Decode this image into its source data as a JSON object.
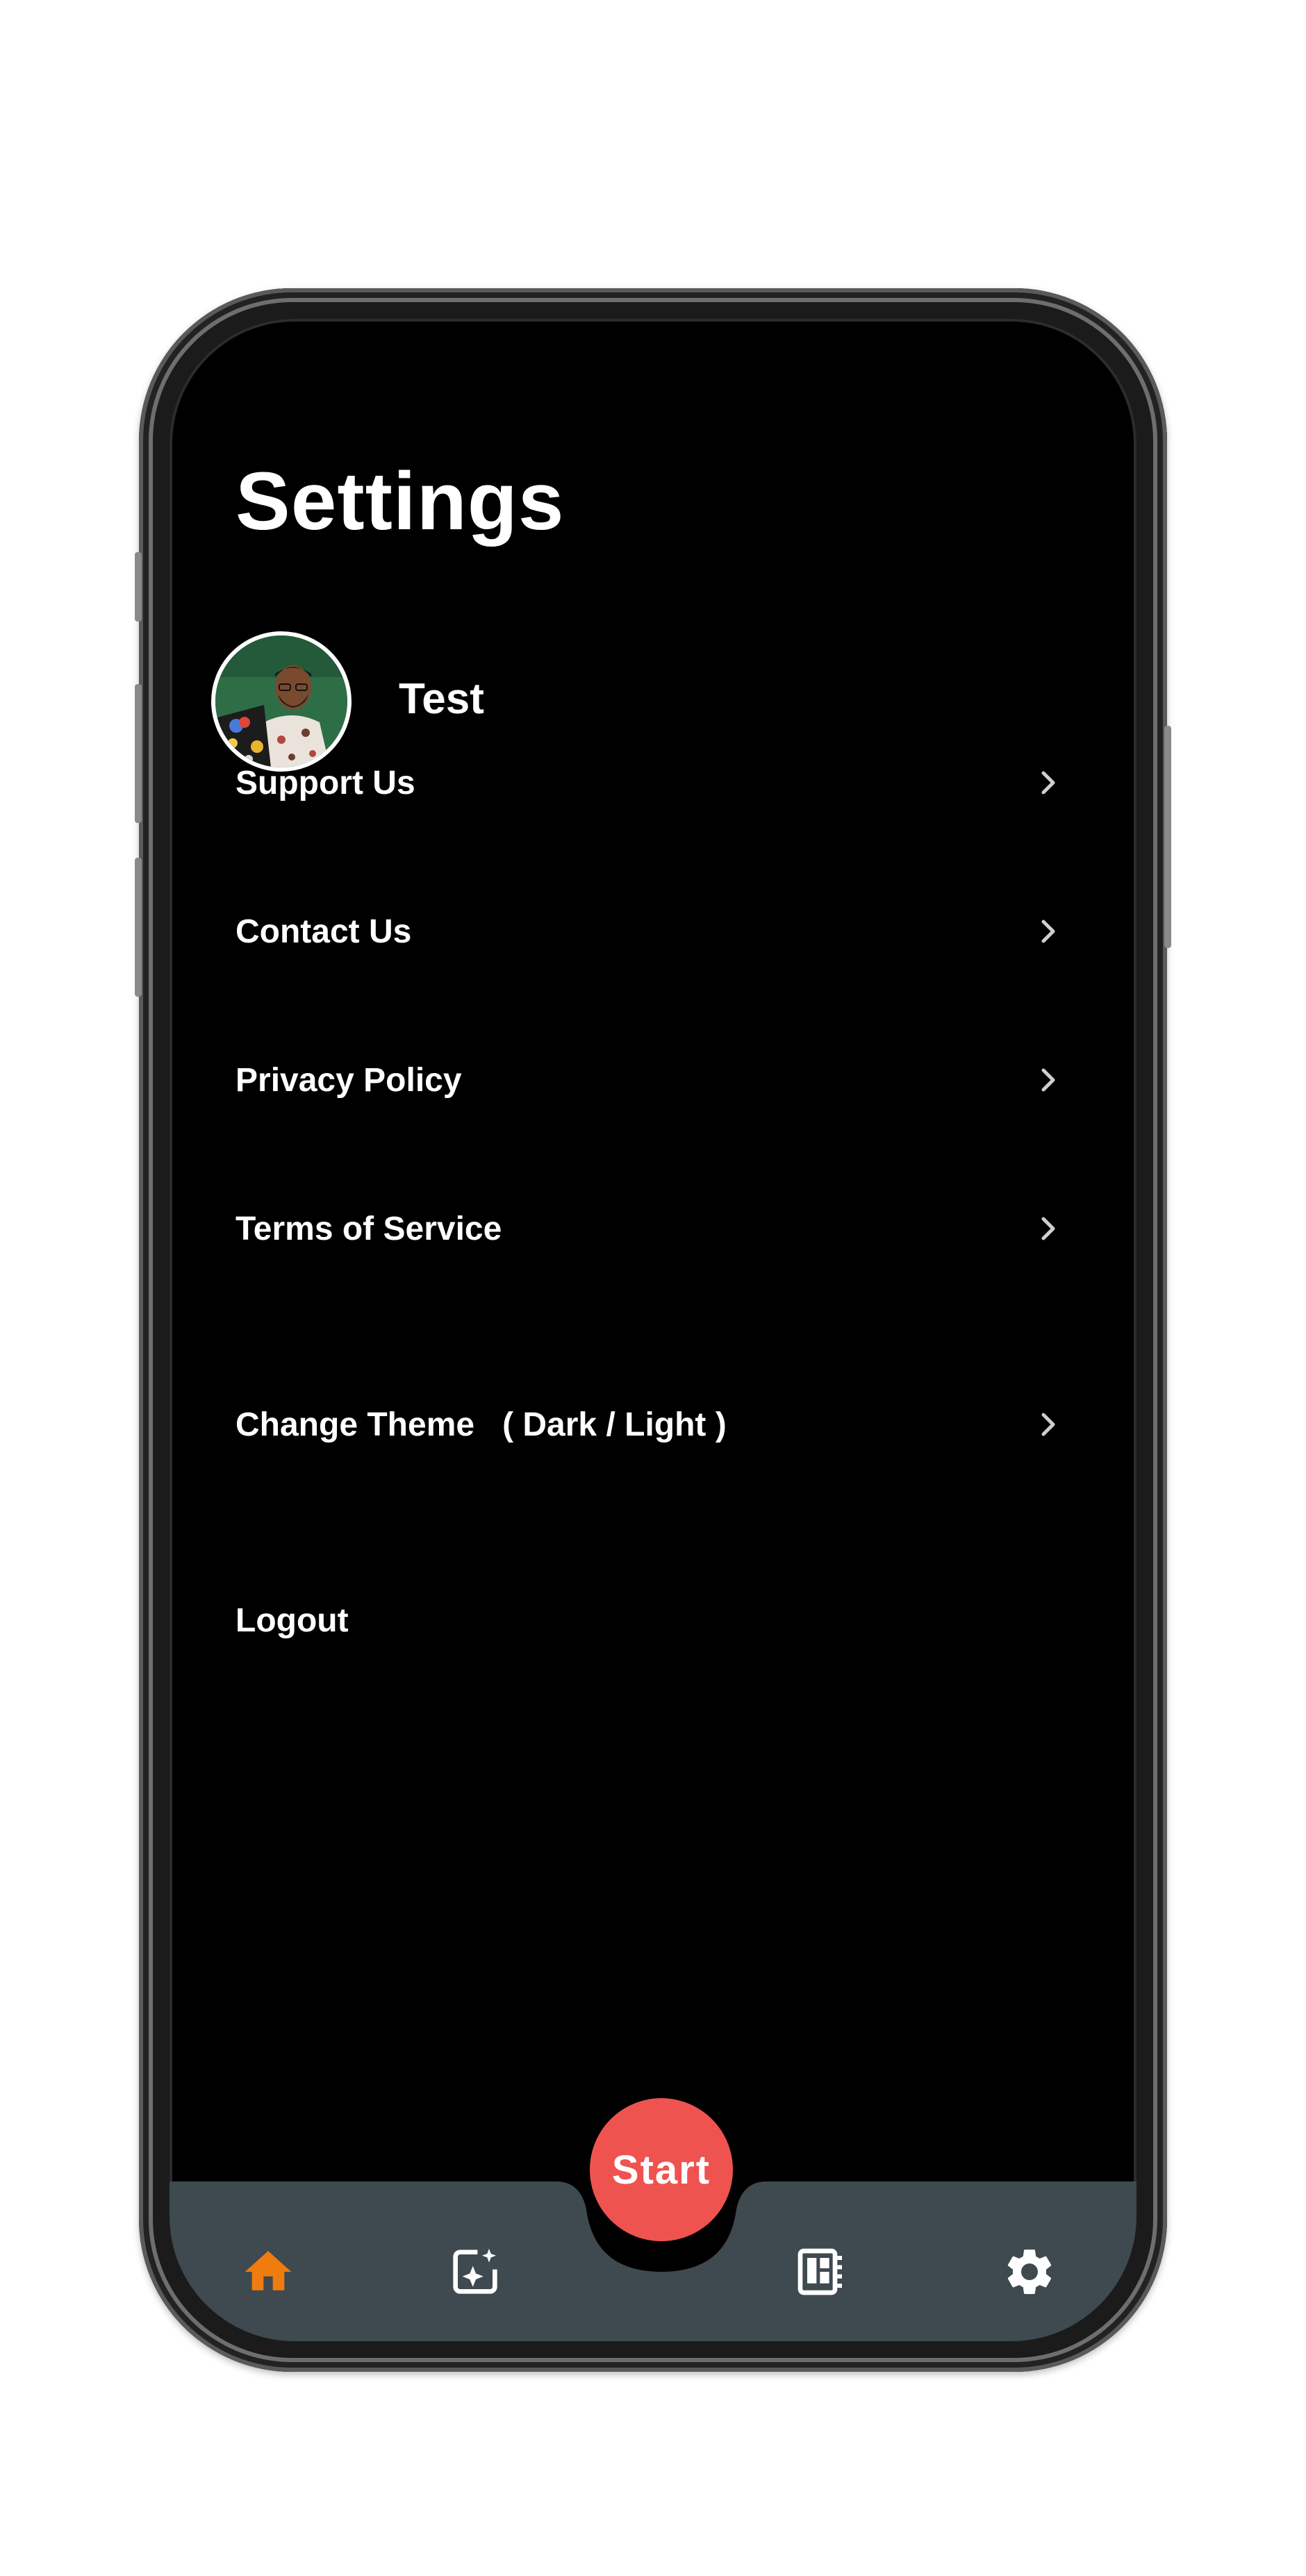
{
  "screen": {
    "title": "Settings"
  },
  "profile": {
    "name": "Test",
    "avatar_icon": "user-photo"
  },
  "menu": [
    {
      "label": "Support Us",
      "has_chevron": true
    },
    {
      "label": "Contact Us",
      "has_chevron": true
    },
    {
      "label": "Privacy Policy",
      "has_chevron": true
    },
    {
      "label": "Terms of Service",
      "has_chevron": true
    },
    {
      "label": "Change Theme   ( Dark / Light )",
      "has_chevron": true
    },
    {
      "label": "Logout",
      "has_chevron": false
    }
  ],
  "bottom_nav": {
    "start_label": "Start",
    "items": [
      {
        "icon": "home-icon",
        "active": true
      },
      {
        "icon": "ai-edit-icon",
        "active": false
      },
      {
        "icon": "dashboard-icon",
        "active": false
      },
      {
        "icon": "settings-icon",
        "active": false
      }
    ]
  },
  "colors": {
    "background": "#000000",
    "nav_bar": "#3e4a4f",
    "accent_active": "#f07c10",
    "start_button": "#ef5350",
    "text": "#ffffff"
  }
}
